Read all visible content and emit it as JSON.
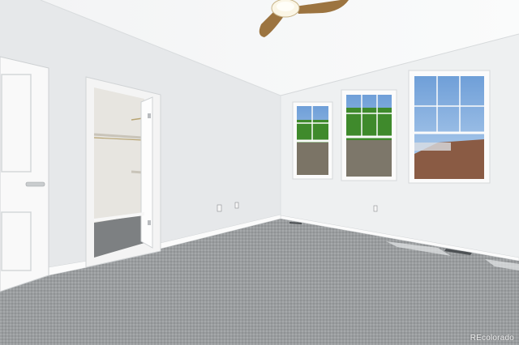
{
  "watermark": "REcolorado",
  "colors": {
    "wall_left": "#e8eaec",
    "wall_right": "#eef0f1",
    "ceiling": "#f6f7f8",
    "carpet": "#9a9d9f",
    "sky": "#8fb7e6",
    "foliage": "#3f8a2c",
    "fan_blade": "#9c7440"
  }
}
